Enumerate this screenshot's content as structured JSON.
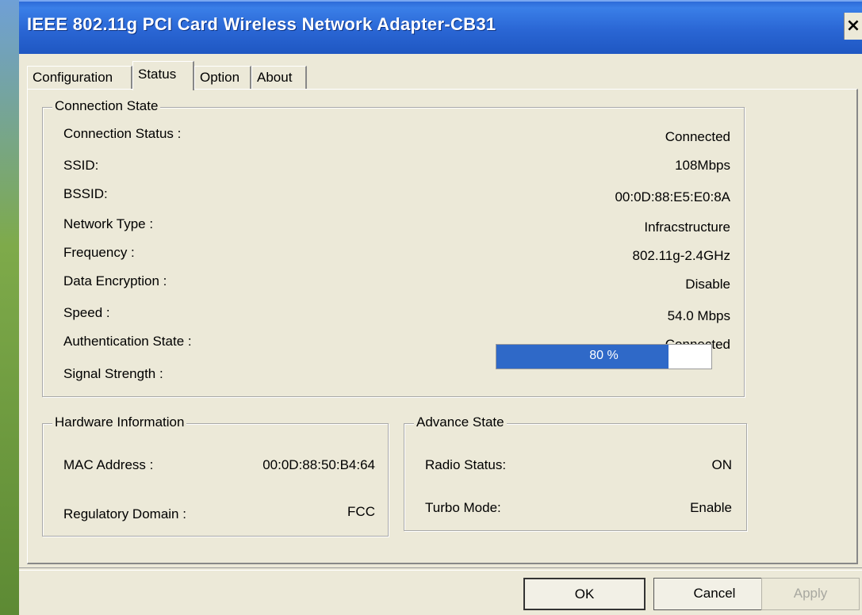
{
  "window": {
    "title": "IEEE 802.11g PCI Card Wireless Network Adapter-CB31",
    "close_glyph": "×"
  },
  "tabs": [
    "Configuration",
    "Status",
    "Option",
    "About"
  ],
  "active_tab": "Status",
  "connection_state": {
    "legend": "Connection State",
    "rows": [
      {
        "label": "Connection Status :",
        "value": "Connected"
      },
      {
        "label": "SSID:",
        "value": "108Mbps"
      },
      {
        "label": "BSSID:",
        "value": "00:0D:88:E5:E0:8A"
      },
      {
        "label": "Network Type :",
        "value": "Infracstructure"
      },
      {
        "label": "Frequency :",
        "value": "802.11g-2.4GHz"
      },
      {
        "label": "Data Encryption :",
        "value": "Disable"
      },
      {
        "label": "Speed :",
        "value": "54.0  Mbps"
      },
      {
        "label": "Authentication State :",
        "value": "Connected"
      }
    ],
    "signal": {
      "label": "Signal Strength :",
      "text": "80 %",
      "percent": 80,
      "color": "#2f69c8"
    }
  },
  "hardware_information": {
    "legend": "Hardware Information",
    "rows": [
      {
        "label": "MAC Address :",
        "value": "00:0D:88:50:B4:64"
      },
      {
        "label": "Regulatory Domain :",
        "value": "FCC"
      }
    ]
  },
  "advance_state": {
    "legend": "Advance State",
    "rows": [
      {
        "label": "Radio Status:",
        "value": "ON"
      },
      {
        "label": "Turbo Mode:",
        "value": "Enable"
      }
    ]
  },
  "buttons": {
    "ok": "OK",
    "cancel": "Cancel",
    "apply": "Apply"
  },
  "colors": {
    "titlebar": "#2a66d4",
    "dialog_bg": "#ece9d8"
  }
}
